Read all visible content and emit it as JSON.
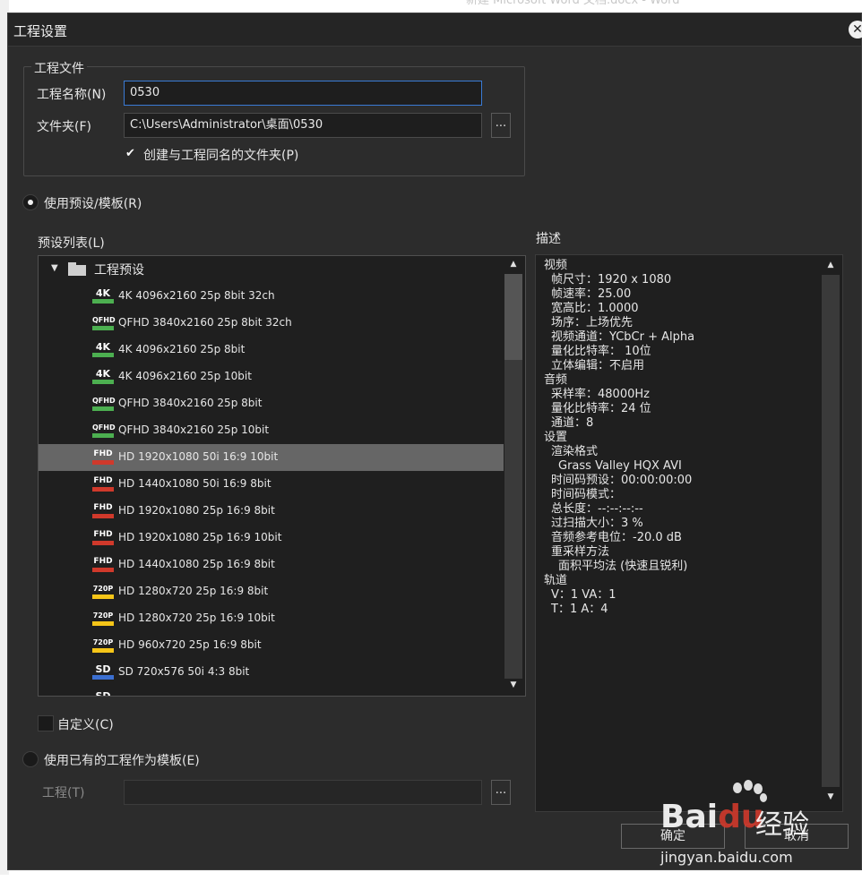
{
  "background_window_title": "新建 Microsoft Word 文档.docx - Word",
  "dialog": {
    "title": "工程设置",
    "close_icon": "close-icon"
  },
  "project_file": {
    "group_title": "工程文件",
    "name_label": "工程名称(N)",
    "name_value": "0530",
    "folder_label": "文件夹(F)",
    "folder_value": "C:\\Users\\Administrator\\桌面\\0530",
    "browse_label": "...",
    "create_folder_checked": true,
    "create_folder_label": "创建与工程同名的文件夹(P)"
  },
  "use_preset": {
    "selected": true,
    "label": "使用预设/模板(R)"
  },
  "preset_list": {
    "label": "预设列表(L)",
    "folder_label": "工程预设",
    "selected_index": 6,
    "items": [
      {
        "badge": "4K",
        "badge_color": "#4caf50",
        "label": "4K 4096x2160 25p 8bit 32ch"
      },
      {
        "badge": "QFHD",
        "badge_color": "#4caf50",
        "label": "QFHD 3840x2160 25p 8bit 32ch"
      },
      {
        "badge": "4K",
        "badge_color": "#4caf50",
        "label": "4K 4096x2160 25p 8bit"
      },
      {
        "badge": "4K",
        "badge_color": "#4caf50",
        "label": "4K 4096x2160 25p 10bit"
      },
      {
        "badge": "QFHD",
        "badge_color": "#4caf50",
        "label": "QFHD 3840x2160 25p 8bit"
      },
      {
        "badge": "QFHD",
        "badge_color": "#4caf50",
        "label": "QFHD 3840x2160 25p 10bit"
      },
      {
        "badge": "FHD",
        "badge_color": "#d0392b",
        "label": "HD 1920x1080 50i 16:9 10bit"
      },
      {
        "badge": "FHD",
        "badge_color": "#d0392b",
        "label": "HD 1440x1080 50i 16:9 8bit"
      },
      {
        "badge": "FHD",
        "badge_color": "#d0392b",
        "label": "HD 1920x1080 25p 16:9 8bit"
      },
      {
        "badge": "FHD",
        "badge_color": "#d0392b",
        "label": "HD 1920x1080 25p 16:9 10bit"
      },
      {
        "badge": "FHD",
        "badge_color": "#d0392b",
        "label": "HD 1440x1080 25p 16:9 8bit"
      },
      {
        "badge": "720P",
        "badge_color": "#f5c518",
        "label": "HD 1280x720 25p 16:9 8bit"
      },
      {
        "badge": "720P",
        "badge_color": "#f5c518",
        "label": "HD 1280x720 25p 16:9 10bit"
      },
      {
        "badge": "720P",
        "badge_color": "#f5c518",
        "label": "HD 960x720 25p 16:9 8bit"
      },
      {
        "badge": "SD",
        "badge_color": "#3b6fd1",
        "label": "SD 720x576 50i 4:3 8bit"
      },
      {
        "badge": "SD",
        "badge_color": "#3b6fd1",
        "label": ""
      }
    ]
  },
  "custom": {
    "checked": false,
    "label": "自定义(C)"
  },
  "use_existing": {
    "selected": false,
    "label": "使用已有的工程作为模板(E)",
    "project_label": "工程(T)",
    "project_value": "",
    "browse_label": "..."
  },
  "description": {
    "label": "描述",
    "lines": [
      {
        "text": "视频",
        "indent": 0
      },
      {
        "text": "帧尺寸：1920 x 1080",
        "indent": 1
      },
      {
        "text": "帧速率：25.00",
        "indent": 1
      },
      {
        "text": "宽高比：1.0000",
        "indent": 1
      },
      {
        "text": "场序：上场优先",
        "indent": 1
      },
      {
        "text": "视频通道：YCbCr + Alpha",
        "indent": 1
      },
      {
        "text": "量化比特率： 10位",
        "indent": 1
      },
      {
        "text": "立体编辑：不启用",
        "indent": 1
      },
      {
        "text": "音频",
        "indent": 0
      },
      {
        "text": "采样率：48000Hz",
        "indent": 1
      },
      {
        "text": "量化比特率：24 位",
        "indent": 1
      },
      {
        "text": "通道：8",
        "indent": 1
      },
      {
        "text": "设置",
        "indent": 0
      },
      {
        "text": "渲染格式",
        "indent": 1
      },
      {
        "text": "Grass Valley HQX AVI",
        "indent": 2
      },
      {
        "text": "时间码预设：00:00:00:00",
        "indent": 1
      },
      {
        "text": "时间码模式：",
        "indent": 1
      },
      {
        "text": "总长度：--:--:--:--",
        "indent": 1
      },
      {
        "text": "过扫描大小：3 %",
        "indent": 1
      },
      {
        "text": "音频参考电位：-20.0 dB",
        "indent": 1
      },
      {
        "text": "重采样方法",
        "indent": 1
      },
      {
        "text": "面积平均法 (快速且锐利)",
        "indent": 2
      },
      {
        "text": "轨道",
        "indent": 0
      },
      {
        "text": "V：1  VA：1",
        "indent": 1
      },
      {
        "text": "T：1  A：4",
        "indent": 1
      }
    ]
  },
  "footer": {
    "ok_label": "确定",
    "cancel_label": "取消"
  },
  "watermark": {
    "brand": "Bai",
    "brand_tail": "du",
    "suffix": "经验",
    "url": "jingyan.baidu.com"
  }
}
